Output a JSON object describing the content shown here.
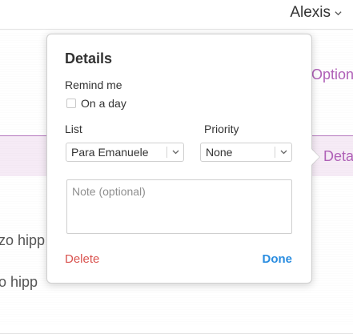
{
  "header": {
    "user_name": "Alexis",
    "chevron_icon": "chevron-down-icon"
  },
  "background_rows": [
    {
      "text": ""
    },
    {
      "text": "Option"
    },
    {
      "text": "Deta"
    },
    {
      "text": "zo hipp"
    },
    {
      "text": "o hipp"
    }
  ],
  "details": {
    "title": "Details",
    "remind_label": "Remind me",
    "on_day_label": "On a day",
    "on_day_checked": false,
    "list_label": "List",
    "list_value": "Para Emanuele",
    "priority_label": "Priority",
    "priority_value": "None",
    "note_placeholder": "Note (optional)",
    "note_value": "",
    "delete_label": "Delete",
    "done_label": "Done"
  },
  "colors": {
    "accent_purple": "#b061b8",
    "delete_red": "#d9534f",
    "done_blue": "#2a8de0"
  }
}
